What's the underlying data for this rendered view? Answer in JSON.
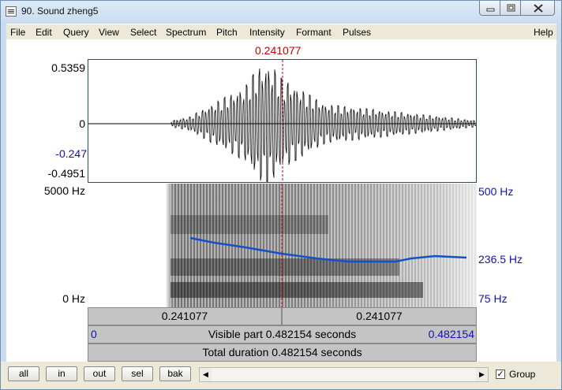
{
  "window": {
    "title": "90. Sound zheng5"
  },
  "menu": [
    "File",
    "Edit",
    "Query",
    "View",
    "Select",
    "Spectrum",
    "Pitch",
    "Intensity",
    "Formant",
    "Pulses",
    "Help"
  ],
  "cursor": {
    "time_label": "0.241077"
  },
  "waveform": {
    "y_max_label": "0.5359",
    "y_zero_label": "0",
    "y_cursor_label": "-0.247",
    "y_min_label": "-0.4951"
  },
  "spectrogram": {
    "freq_top_label": "5000 Hz",
    "freq_bottom_label": "0 Hz"
  },
  "pitch": {
    "top_label": "500 Hz",
    "mid_label": "236.5 Hz",
    "bottom_label": "75 Hz"
  },
  "bars": {
    "segment_left": "0.241077",
    "segment_right": "0.241077",
    "visible_start": "0",
    "visible_text": "Visible part 0.482154 seconds",
    "visible_end": "0.482154",
    "total_text": "Total duration 0.482154 seconds"
  },
  "buttons": {
    "all": "all",
    "in": "in",
    "out": "out",
    "sel": "sel",
    "bak": "bak"
  },
  "group": {
    "label": "Group",
    "checked": true
  }
}
